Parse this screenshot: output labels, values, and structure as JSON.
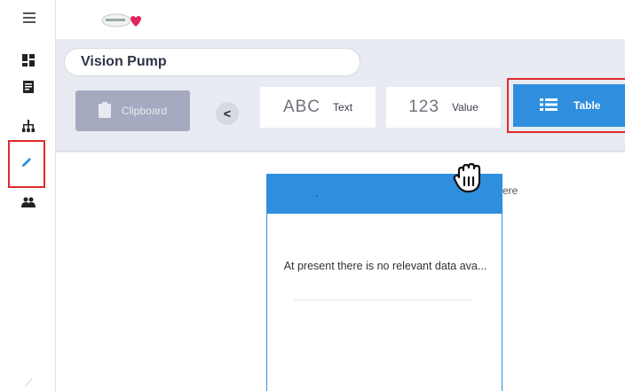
{
  "sidebar": {
    "icons": [
      "menu-icon",
      "dashboard-icon",
      "panel-icon",
      "hierarchy-icon",
      "pencil-icon",
      "users-icon"
    ],
    "active": "pencil-icon"
  },
  "header": {
    "logo": "logo"
  },
  "editor": {
    "title_value": "Vision Pump",
    "clipboard_label": "Clipboard",
    "back_label": "<",
    "widgets": {
      "text": {
        "glyph": "ABC",
        "label": "Text"
      },
      "value": {
        "glyph": "123",
        "label": "Value"
      },
      "table": {
        "label": "Table",
        "selected": true
      }
    }
  },
  "canvas": {
    "background_fragment": "ere",
    "table_widget": {
      "header_text": ".",
      "empty_message": "At present there is no relevant data ava..."
    }
  },
  "colors": {
    "accent": "#2f8fde",
    "highlight": "#e02b2b",
    "toolbar_bg": "#e9ebf3",
    "clipboard_disabled": "#a6aac0"
  }
}
